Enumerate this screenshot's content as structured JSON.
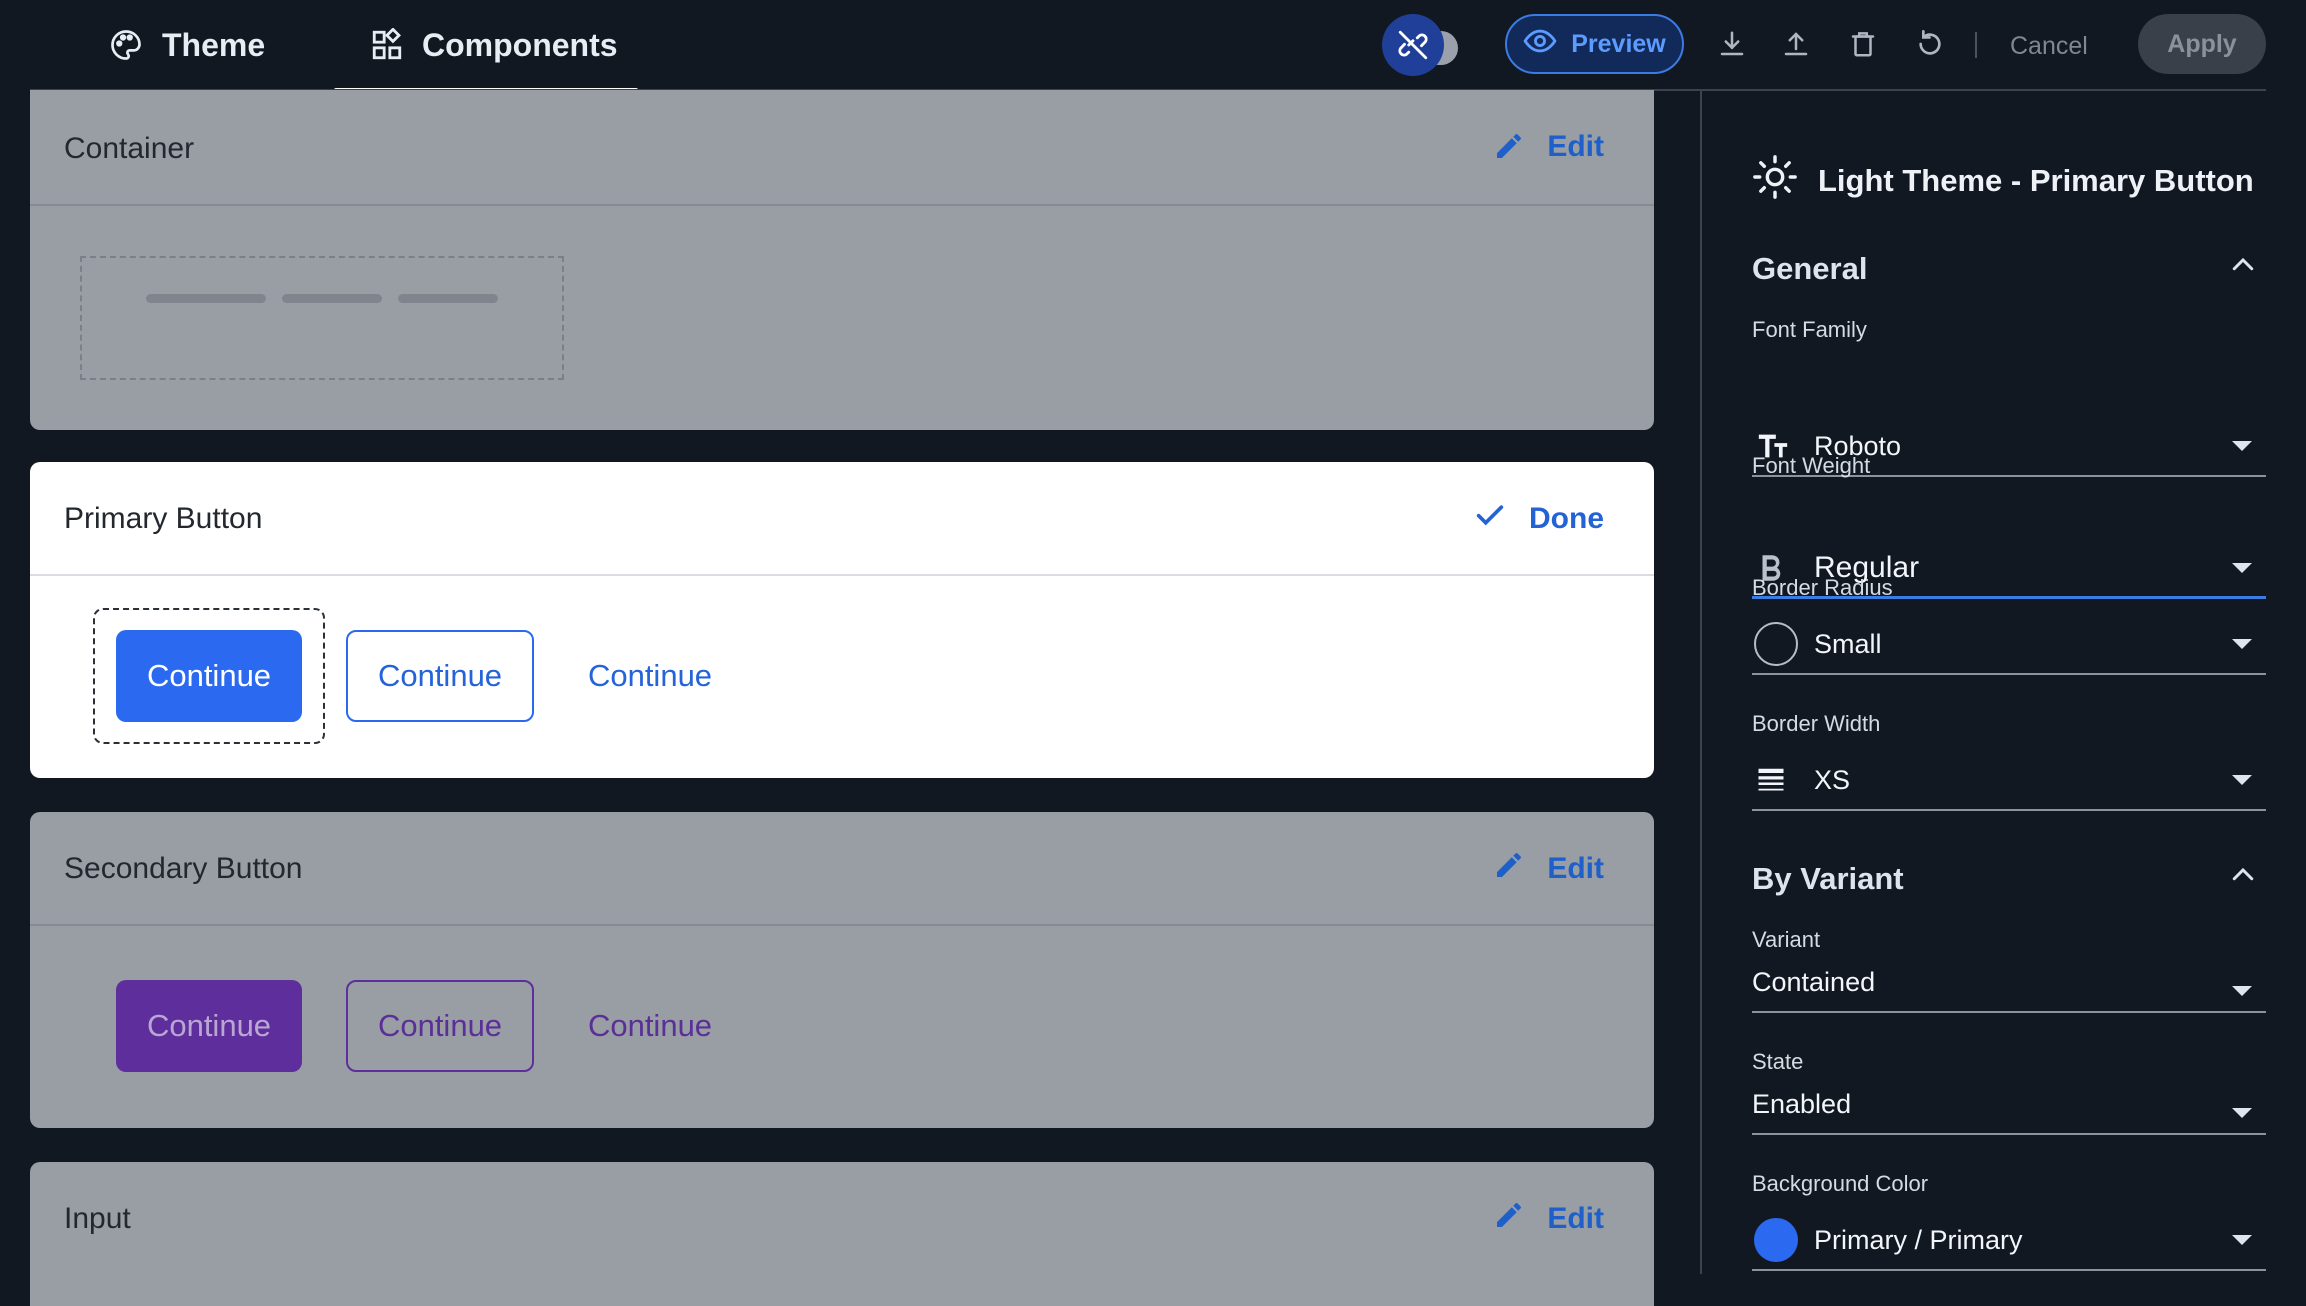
{
  "tabs": [
    {
      "label": "Theme",
      "icon": "palette-icon"
    },
    {
      "label": "Components",
      "icon": "components-grid-icon"
    }
  ],
  "toolbar": {
    "preview_label": "Preview",
    "cancel_label": "Cancel",
    "apply_label": "Apply",
    "icons": [
      "link-off-icon",
      "download-icon",
      "upload-icon",
      "trash-icon",
      "reset-icon",
      "eye-icon"
    ]
  },
  "cards": {
    "container": {
      "title": "Container",
      "action": "Edit"
    },
    "primary": {
      "title": "Primary Button",
      "action": "Done",
      "buttons": [
        "Continue",
        "Continue",
        "Continue"
      ]
    },
    "secondary": {
      "title": "Secondary Button",
      "action": "Edit",
      "buttons": [
        "Continue",
        "Continue",
        "Continue"
      ]
    },
    "input": {
      "title": "Input",
      "action": "Edit"
    }
  },
  "panel": {
    "title": "Light Theme - Primary Button",
    "general": {
      "heading": "General",
      "font_family": {
        "label": "Font Family",
        "value": "Roboto"
      },
      "font_weight": {
        "label": "Font Weight",
        "value": "Regular"
      },
      "border_radius": {
        "label": "Border Radius",
        "value": "Small"
      },
      "border_width": {
        "label": "Border Width",
        "value": "XS"
      }
    },
    "by_variant": {
      "heading": "By Variant",
      "variant": {
        "label": "Variant",
        "value": "Contained"
      },
      "state": {
        "label": "State",
        "value": "Enabled"
      },
      "background_color": {
        "label": "Background Color",
        "value": "Primary / Primary",
        "swatch": "#2b6af0"
      }
    }
  },
  "colors": {
    "background": "#121821",
    "accent": "#2b6af0",
    "secondary": "#5e2e9c",
    "dimmed_card": "#999ea5"
  }
}
